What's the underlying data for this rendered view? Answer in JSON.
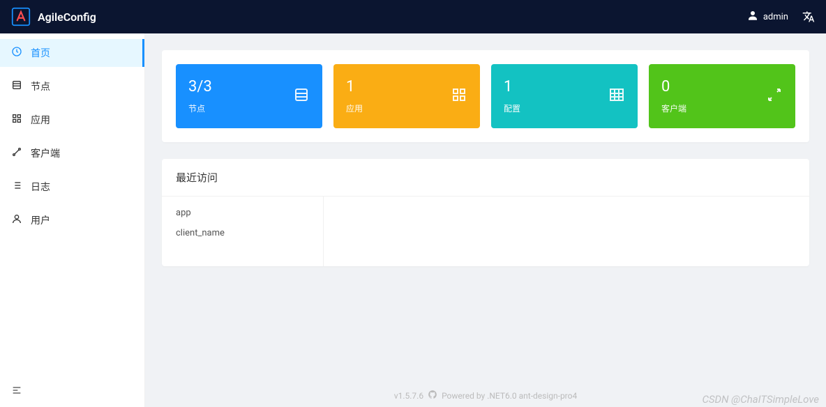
{
  "header": {
    "title": "AgileConfig",
    "username": "admin"
  },
  "sidebar": {
    "items": [
      {
        "label": "首页",
        "icon": "dashboard",
        "active": true
      },
      {
        "label": "节点",
        "icon": "list",
        "active": false
      },
      {
        "label": "应用",
        "icon": "grid",
        "active": false
      },
      {
        "label": "客户端",
        "icon": "connect",
        "active": false
      },
      {
        "label": "日志",
        "icon": "loglist",
        "active": false
      },
      {
        "label": "用户",
        "icon": "user",
        "active": false
      }
    ]
  },
  "stats": [
    {
      "value": "3/3",
      "label": "节点",
      "color": "#1890ff",
      "icon": "list"
    },
    {
      "value": "1",
      "label": "应用",
      "color": "#faad14",
      "icon": "grid"
    },
    {
      "value": "1",
      "label": "配置",
      "color": "#13c2c2",
      "icon": "table"
    },
    {
      "value": "0",
      "label": "客户端",
      "color": "#52c41a",
      "icon": "expand"
    }
  ],
  "recent": {
    "title": "最近访问",
    "items": [
      "app",
      "client_name"
    ]
  },
  "footer": {
    "version": "v1.5.7.6",
    "powered": "Powered by .NET6.0 ant-design-pro4"
  },
  "watermark": "CSDN @ChaITSimpleLove"
}
